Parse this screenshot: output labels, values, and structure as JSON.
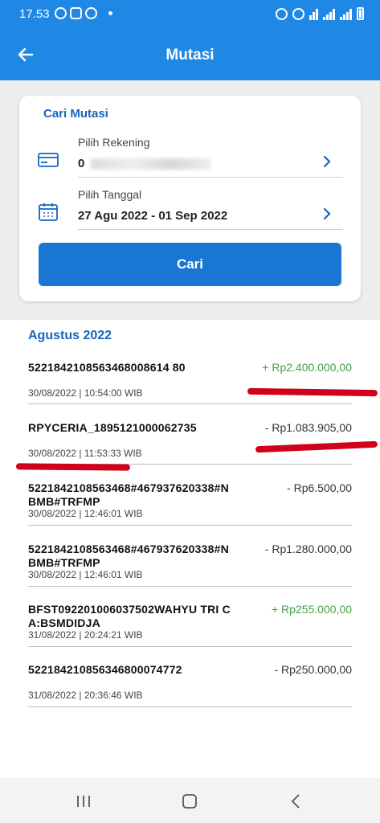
{
  "status_bar": {
    "time": "17.53"
  },
  "header": {
    "title": "Mutasi"
  },
  "search": {
    "title": "Cari Mutasi",
    "account_label": "Pilih Rekening",
    "account_value": "0",
    "date_label": "Pilih Tanggal",
    "date_value": "27 Agu 2022 - 01 Sep 2022",
    "button_label": "Cari"
  },
  "month": "Agustus 2022",
  "transactions": [
    {
      "desc": "5221842108563468008614 80",
      "amount": "+ Rp2.400.000,00",
      "date": "30/08/2022 | 10:54:00 WIB",
      "type": "credit"
    },
    {
      "desc": "RPYCERIA_1895121000062735",
      "amount": "- Rp1.083.905,00",
      "date": "30/08/2022 | 11:53:33 WIB",
      "type": "debit"
    },
    {
      "desc": "5221842108563468#467937620338#NBMB#TRFMP",
      "amount": "- Rp6.500,00",
      "date": "30/08/2022 | 12:46:01 WIB",
      "type": "debit"
    },
    {
      "desc": "5221842108563468#467937620338#NBMB#TRFMP",
      "amount": "- Rp1.280.000,00",
      "date": "30/08/2022 | 12:46:01 WIB",
      "type": "debit"
    },
    {
      "desc": "BFST092201006037502WAHYU TRI CA:BSMDIDJA",
      "amount": "+ Rp255.000,00",
      "date": "31/08/2022 | 20:24:21 WIB",
      "type": "credit"
    },
    {
      "desc": "522184210856346800074772",
      "amount": "- Rp250.000,00",
      "date": "31/08/2022 | 20:36:46 WIB",
      "type": "debit"
    }
  ],
  "colors": {
    "primary": "#1f88e5",
    "button": "#1976d2",
    "credit": "#43a047",
    "accent_text": "#1565c0",
    "marker": "#d0021b"
  },
  "icons": [
    "back-arrow-icon",
    "card-icon",
    "calendar-icon",
    "chevron-right-icon",
    "recent-apps-icon",
    "home-icon",
    "nav-back-icon"
  ]
}
